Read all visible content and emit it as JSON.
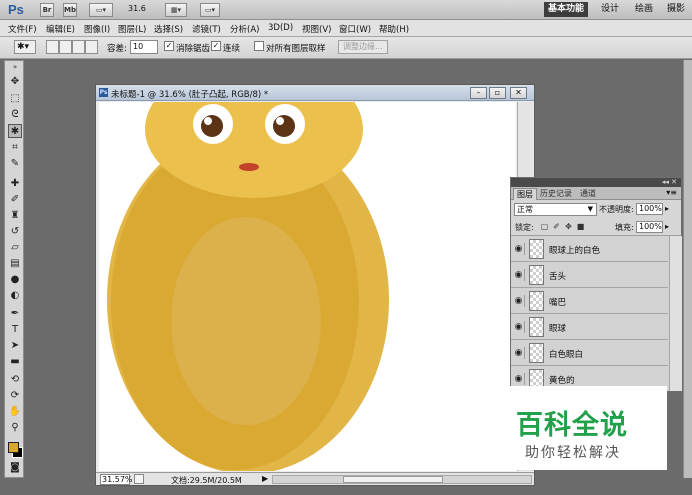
{
  "appbar": {
    "logo": "Ps",
    "btn_br": "Br",
    "btn_mb": "Mb",
    "zoom": "31.6",
    "workspaces": [
      "基本功能",
      "设计",
      "绘画",
      "摄影"
    ],
    "active_workspace": "基本功能"
  },
  "menu": [
    "文件(F)",
    "编辑(E)",
    "图像(I)",
    "图层(L)",
    "选择(S)",
    "滤镜(T)",
    "分析(A)",
    "3D(D)",
    "视图(V)",
    "窗口(W)",
    "帮助(H)"
  ],
  "options": {
    "tolerance_label": "容差:",
    "tolerance_value": "10",
    "antialias_label": "消除锯齿",
    "contiguous_label": "连续",
    "all_layers_label": "对所有图层取样",
    "refine_edge_label": "调整边缘..."
  },
  "document": {
    "title": "未标题-1 @ 31.6% (肚子凸起, RGB/8) *",
    "zoom": "31.57%",
    "doc_size": "文档:29.5M/20.5M",
    "colors": {
      "head": "#ebc04d",
      "body_outer": "#e2b547",
      "body_mid": "#d9a932",
      "belly": "#dcb04a",
      "eye_white": "#ffffff",
      "pupil": "#5c3314",
      "mouth": "#c2412a"
    }
  },
  "toolbox": {
    "foreground_color": "#d8a836",
    "background_color": "#000000",
    "tools": [
      "move-tool",
      "marquee-tool",
      "lasso-tool",
      "magic-wand-tool",
      "crop-tool",
      "eyedropper-tool",
      "healing-brush-tool",
      "brush-tool",
      "clone-stamp-tool",
      "history-brush-tool",
      "eraser-tool",
      "gradient-tool",
      "blur-tool",
      "dodge-tool",
      "pen-tool",
      "type-tool",
      "path-selection-tool",
      "shape-tool",
      "3d-rotate-tool",
      "3d-orbit-tool",
      "hand-tool",
      "zoom-tool"
    ]
  },
  "layers_panel": {
    "tabs": [
      "图层",
      "历史记录",
      "通道"
    ],
    "blend_mode": "正常",
    "opacity_label": "不透明度:",
    "opacity_value": "100%",
    "lock_label": "锁定:",
    "fill_label": "填充:",
    "fill_value": "100%",
    "layers": [
      "眼球上的白色",
      "舌头",
      "嘴巴",
      "眼球",
      "白色眼白",
      "黄色的"
    ]
  },
  "watermark": {
    "title": "百科全说",
    "subtitle": "助你轻松解决"
  }
}
